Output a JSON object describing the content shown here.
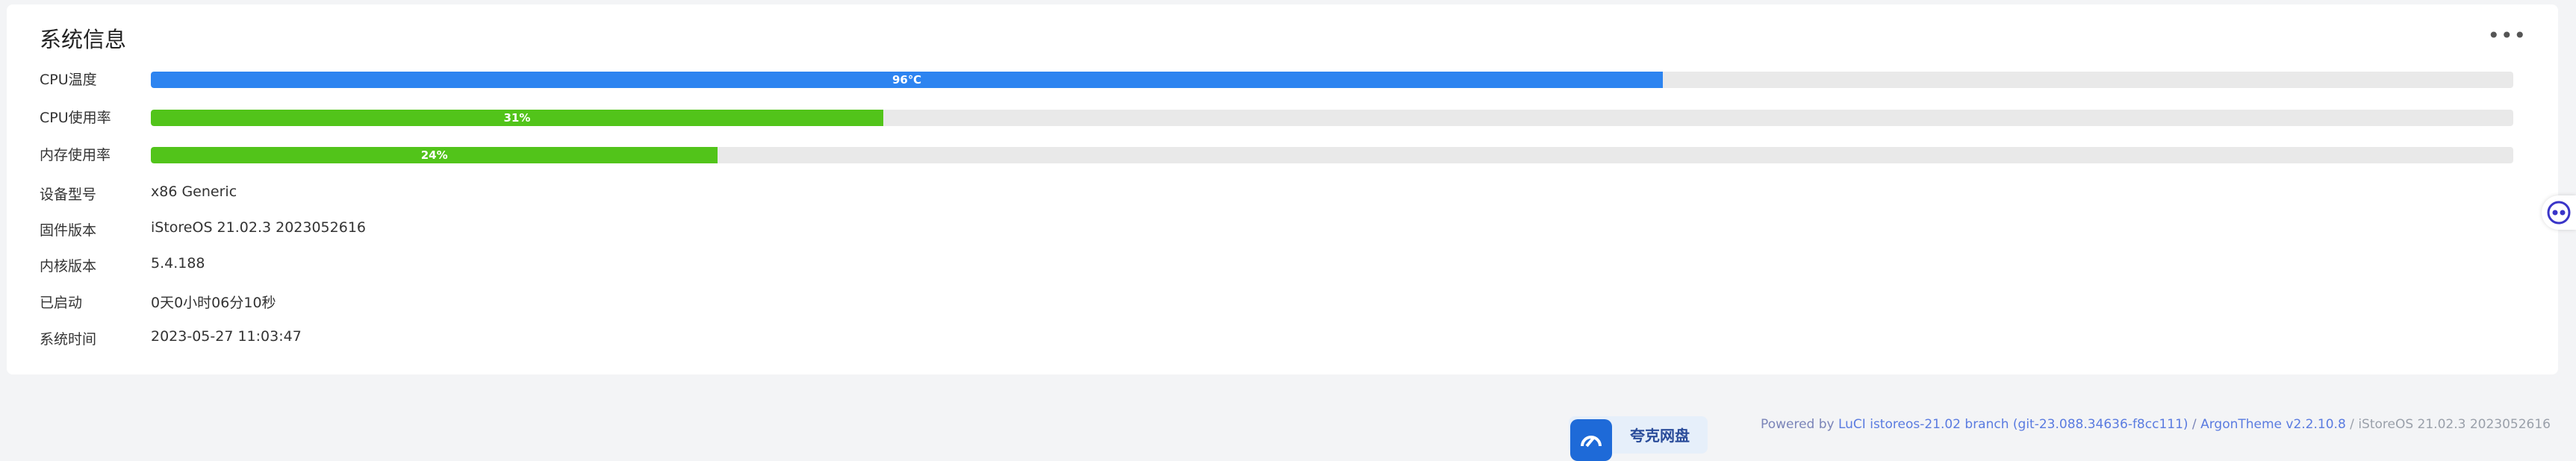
{
  "panel": {
    "title": "系统信息",
    "menu_label": "•••",
    "bars": [
      {
        "label": "CPU温度",
        "text": "96℃",
        "percent": 64,
        "color": "#2d84f0"
      },
      {
        "label": "CPU使用率",
        "text": "31%",
        "percent": 31,
        "color": "#52c41a"
      },
      {
        "label": "内存使用率",
        "text": "24%",
        "percent": 24,
        "color": "#52c41a"
      }
    ],
    "rows": [
      {
        "label": "设备型号",
        "value": "x86 Generic"
      },
      {
        "label": "固件版本",
        "value": "iStoreOS 21.02.3 2023052616"
      },
      {
        "label": "内核版本",
        "value": "5.4.188"
      },
      {
        "label": "已启动",
        "value": "0天0小时06分10秒"
      },
      {
        "label": "系统时间",
        "value": "2023-05-27 11:03:47"
      }
    ]
  },
  "badge": {
    "text": "夸克网盘",
    "icon": "cloud-icon"
  },
  "footer": {
    "powered_by": "Powered by ",
    "luci_link": "LuCI istoreos-21.02 branch (git-23.088.34636-f8cc111)",
    "sep1": " / ",
    "theme_link": "ArgonTheme v2.2.10.8",
    "sep2": " / ",
    "version": "iStoreOS 21.02.3 2023052616"
  },
  "side_button": {
    "icon": "eyes-icon"
  }
}
